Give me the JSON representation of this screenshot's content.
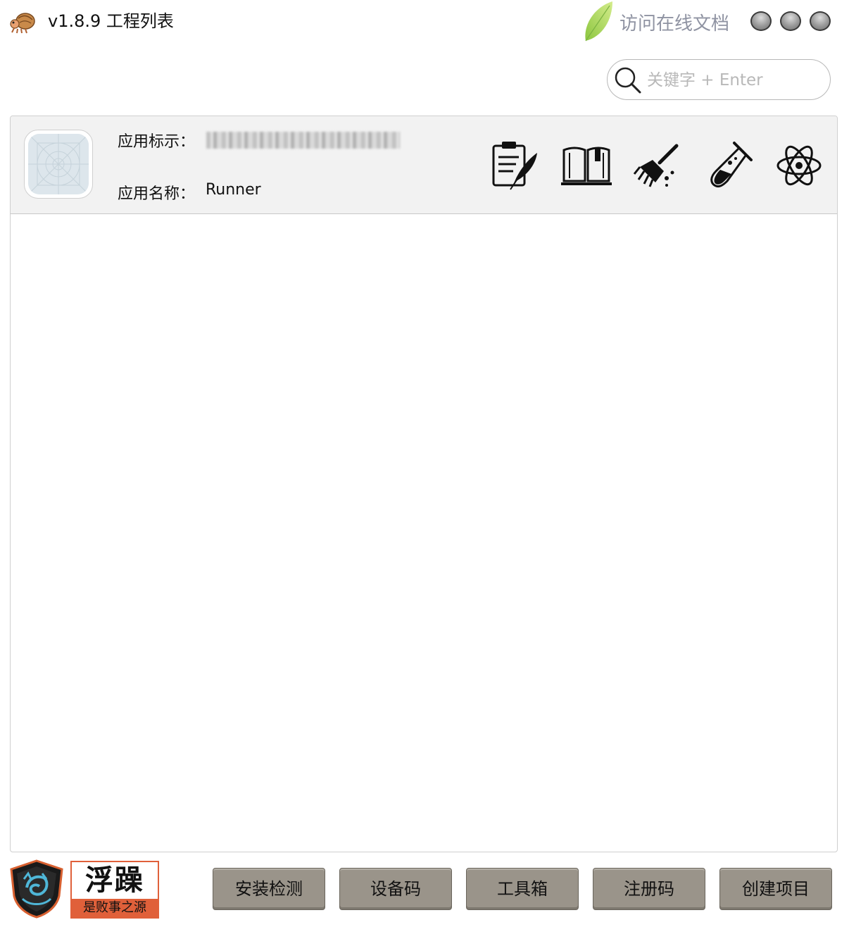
{
  "title_bar": {
    "title": "v1.8.9 工程列表",
    "doc_link_label": "访问在线文档",
    "window_buttons": [
      "minimize",
      "maximize",
      "close"
    ]
  },
  "search": {
    "placeholder": "关键字 + Enter",
    "value": ""
  },
  "project": {
    "bundle_label": "应用标示：",
    "bundle_value_note": "blurred",
    "name_label": "应用名称：",
    "name_value": "Runner",
    "tools": [
      "notes-icon",
      "book-icon",
      "broom-icon",
      "test-tube-icon",
      "atom-icon"
    ]
  },
  "footer": {
    "slogan_big": "浮躁",
    "slogan_small": "是败事之源",
    "buttons": [
      "安装检测",
      "设备码",
      "工具箱",
      "注册码",
      "创建项目"
    ]
  },
  "colors": {
    "button_bg": "#9a948a",
    "row_bg": "#f2f2f2",
    "doc_link": "#8f93a2",
    "slogan_bg": "#e0603a"
  }
}
